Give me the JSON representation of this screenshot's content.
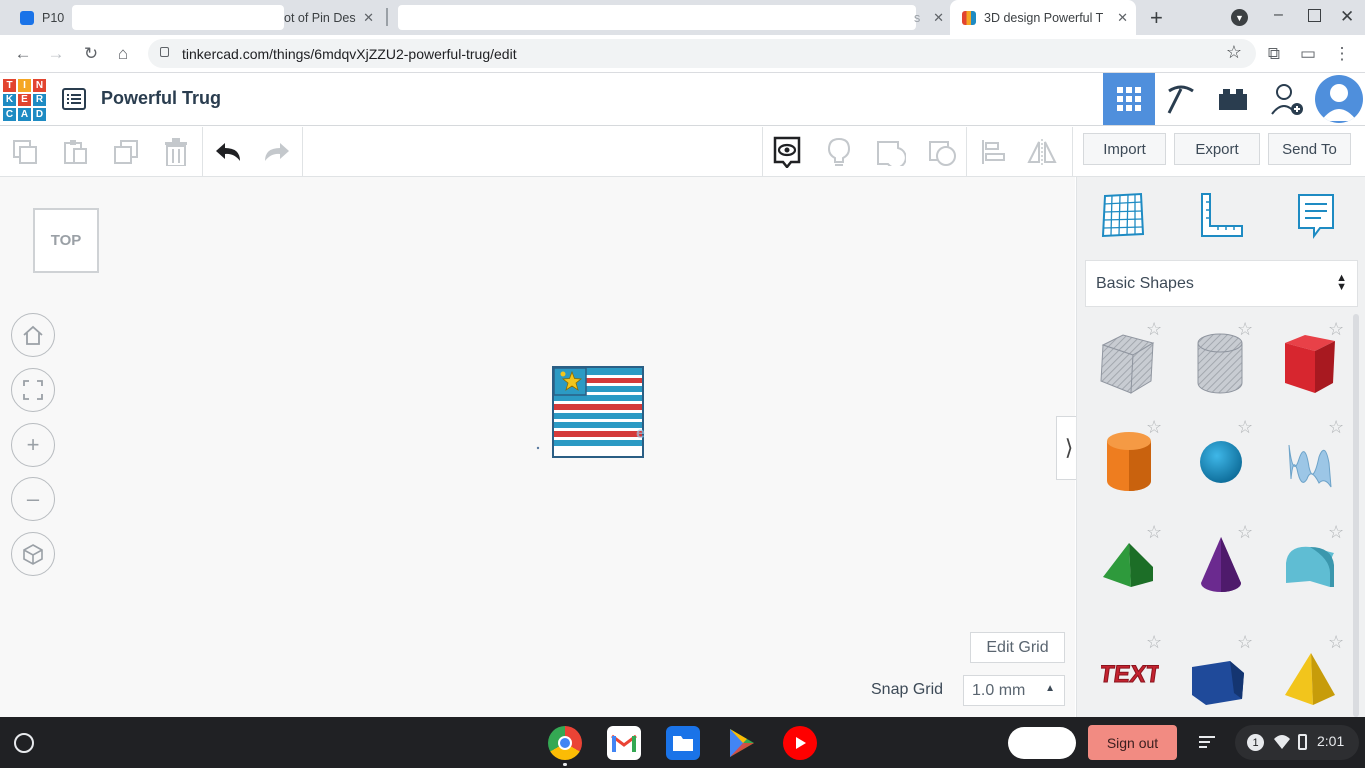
{
  "browser": {
    "tabs": [
      {
        "label": "P10",
        "fav_color": "#1a73e8"
      },
      {
        "label": "ot of Pin Des",
        "fav_color": "#ffffff"
      },
      {
        "label": "s",
        "fav_color": "#ffffff"
      },
      {
        "label": "3D design Powerful T",
        "fav_color": "#e8ae2a"
      }
    ],
    "new_tab_label": "+",
    "url": "tinkercad.com/things/6mdqvXjZZU2-powerful-trug/edit"
  },
  "app": {
    "logo_letters": [
      "T",
      "I",
      "N",
      "K",
      "E",
      "R",
      "C",
      "A",
      "D"
    ],
    "logo_colors": [
      "#e2442f",
      "#f5a623",
      "#e2442f",
      "#1e8bc3",
      "#e2442f",
      "#1e8bc3",
      "#1e8bc3",
      "#1e8bc3",
      "#1e8bc3"
    ],
    "design_title": "Powerful Trug",
    "accent_color": "#4f8fdc"
  },
  "toolbar": {
    "import_label": "Import",
    "export_label": "Export",
    "send_to_label": "Send To"
  },
  "workplane": {
    "viewcube_label": "TOP",
    "edit_grid_label": "Edit Grid",
    "snap_grid_label": "Snap Grid",
    "snap_grid_value": "1.0 mm"
  },
  "panel": {
    "category": "Basic Shapes",
    "shapes": [
      {
        "name": "box-hole",
        "color": "#b7bcc4"
      },
      {
        "name": "cylinder-hole",
        "color": "#c2c6cc"
      },
      {
        "name": "box",
        "color": "#d7262f"
      },
      {
        "name": "cylinder",
        "color": "#ee7d1f"
      },
      {
        "name": "sphere",
        "color": "#1991c9"
      },
      {
        "name": "scribble",
        "color": "#9cc6e6"
      },
      {
        "name": "roof",
        "color": "#2e9a3c"
      },
      {
        "name": "cone",
        "color": "#6b2a8f"
      },
      {
        "name": "round-roof",
        "color": "#5fbdd3"
      },
      {
        "name": "text",
        "color": "#c42330"
      },
      {
        "name": "polygon",
        "color": "#1f4a9a"
      },
      {
        "name": "pyramid",
        "color": "#f2c51c"
      }
    ]
  },
  "shelf": {
    "sign_out_label": "Sign out",
    "notification_count": "1",
    "time": "2:01"
  }
}
